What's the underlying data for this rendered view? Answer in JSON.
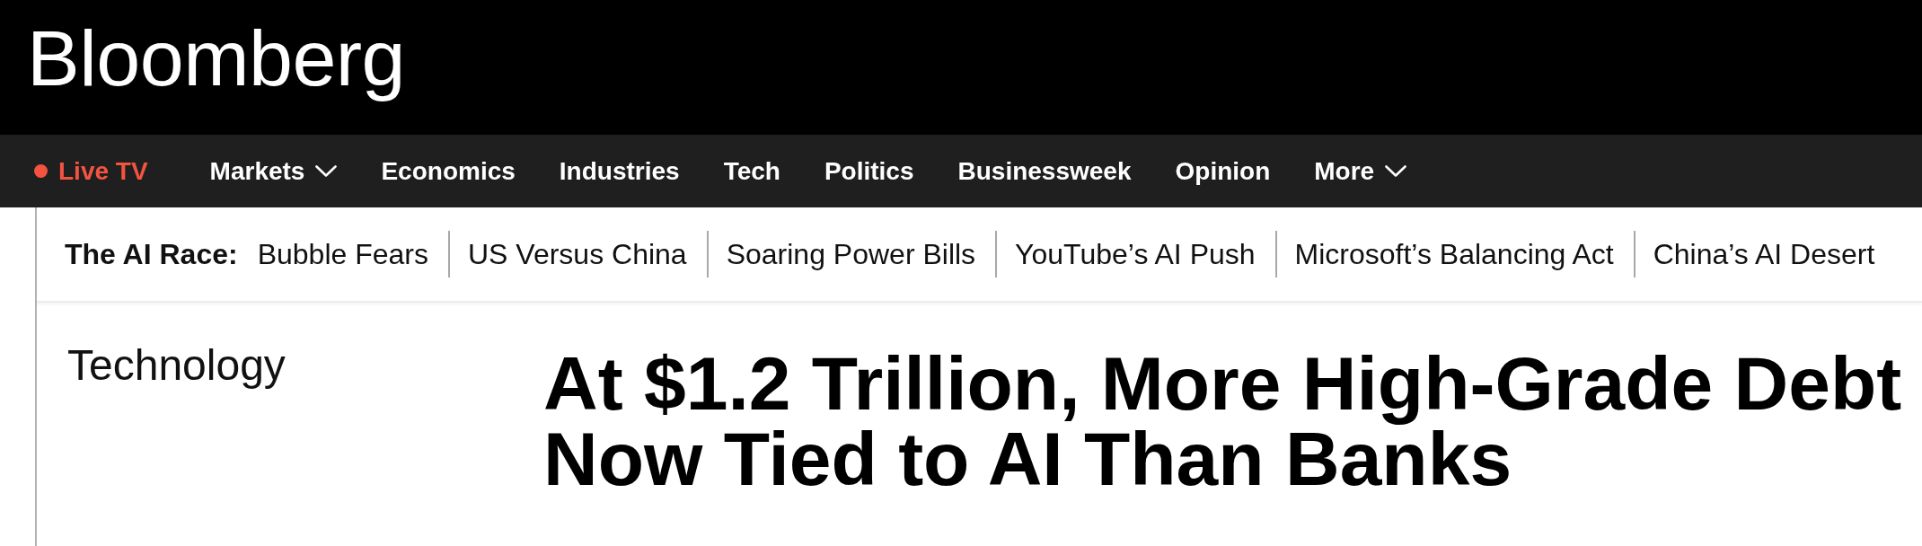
{
  "masthead": {
    "logo": "Bloomberg"
  },
  "nav": {
    "items": [
      {
        "label": "Live TV",
        "kind": "live"
      },
      {
        "label": "Markets",
        "kind": "menu"
      },
      {
        "label": "Economics",
        "kind": "link"
      },
      {
        "label": "Industries",
        "kind": "link"
      },
      {
        "label": "Tech",
        "kind": "link"
      },
      {
        "label": "Politics",
        "kind": "link"
      },
      {
        "label": "Businessweek",
        "kind": "link"
      },
      {
        "label": "Opinion",
        "kind": "link"
      },
      {
        "label": "More",
        "kind": "menu"
      }
    ]
  },
  "topic_bar": {
    "label": "The AI Race:",
    "links": [
      "Bubble Fears",
      "US Versus China",
      "Soaring Power Bills",
      "YouTube’s AI Push",
      "Microsoft’s Balancing Act",
      "China’s AI Desert"
    ]
  },
  "article": {
    "section": "Technology",
    "headline": "At $1.2 Trillion, More High-Grade Debt Now Tied to AI Than Banks"
  }
}
